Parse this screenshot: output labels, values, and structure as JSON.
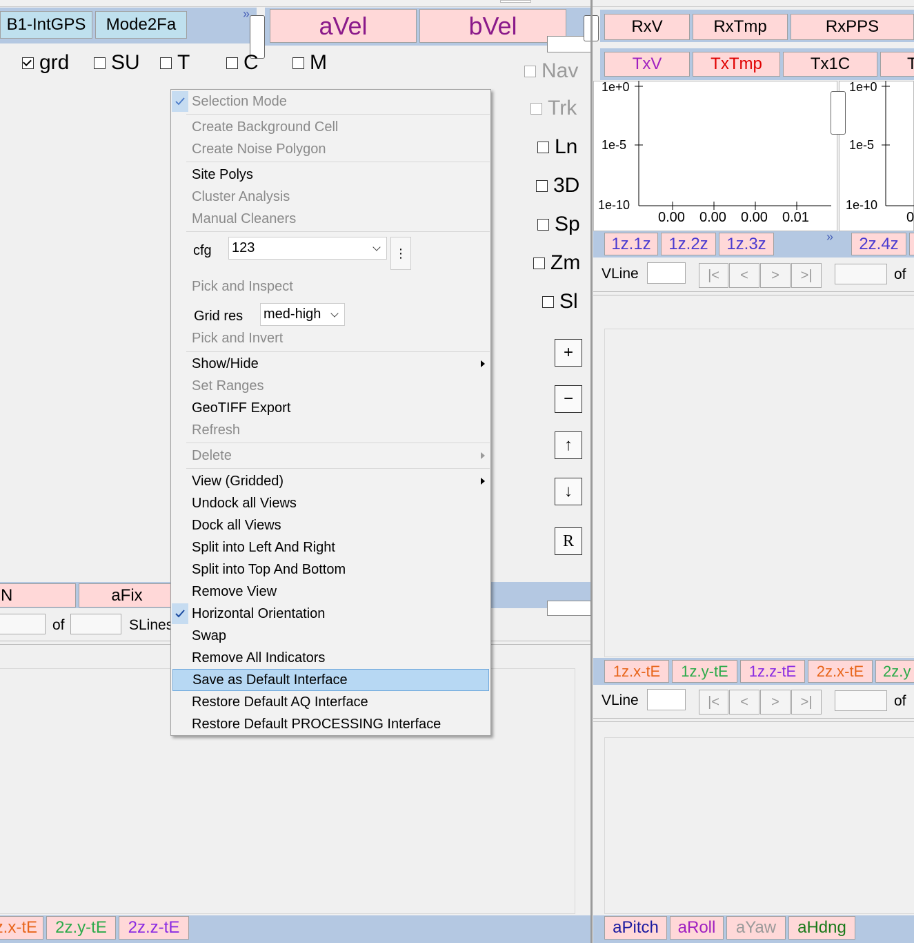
{
  "left_top_tabs": [
    "B1-IntGPS",
    "Mode2Fa"
  ],
  "center_tabs": [
    "aVel",
    "bVel"
  ],
  "checkboxes_top": [
    {
      "label": "grd",
      "checked": true
    },
    {
      "label": "SU",
      "checked": false
    },
    {
      "label": "T",
      "checked": false
    },
    {
      "label": "C",
      "checked": false
    },
    {
      "label": "M",
      "checked": false
    }
  ],
  "side_checkboxes": [
    {
      "label": "Nav",
      "enabled": false
    },
    {
      "label": "Trk",
      "enabled": false
    },
    {
      "label": "Ln",
      "enabled": true
    },
    {
      "label": "3D",
      "enabled": true
    },
    {
      "label": "Sp",
      "enabled": true
    },
    {
      "label": "Zm",
      "enabled": true
    },
    {
      "label": "Sl",
      "enabled": true
    }
  ],
  "side_buttons": [
    "+",
    "−",
    "↑",
    "↓",
    "R"
  ],
  "right_tabs_row1": [
    "RxV",
    "RxTmp",
    "RxPPS"
  ],
  "right_tabs_row2": [
    {
      "label": "TxV",
      "color": "#a020c0"
    },
    {
      "label": "TxTmp",
      "color": "#e00000"
    },
    {
      "label": "Tx1C",
      "color": "#000000"
    },
    {
      "label": "T",
      "color": "#000000"
    }
  ],
  "plot": {
    "y_ticks": [
      "1e+0",
      "1e-5",
      "1e-10"
    ],
    "x_ticks": [
      "0.00",
      "0.00",
      "0.00",
      "0.01"
    ],
    "y_ticks_2": [
      "1e+0",
      "1e-5",
      "1e-10"
    ],
    "x_tick_2": "0"
  },
  "z_tabs": [
    "1z.1z",
    "1z.2z",
    "1z.3z",
    "2z.4z"
  ],
  "nav1": {
    "label": "VLine",
    "buttons": [
      "|<",
      "<",
      ">",
      ">|"
    ],
    "of": "of"
  },
  "mid_left_tabs": [
    "N",
    "aFix"
  ],
  "mid_left_nav": {
    "of": "of",
    "label": "SLines"
  },
  "tE_tabs_right": [
    {
      "label": "1z.x-tE",
      "color": "#e8661c"
    },
    {
      "label": "1z.y-tE",
      "color": "#2caa4a"
    },
    {
      "label": "1z.z-tE",
      "color": "#8a2be2"
    },
    {
      "label": "2z.x-tE",
      "color": "#e8661c"
    },
    {
      "label": "2z.y",
      "color": "#2caa4a"
    }
  ],
  "nav2": {
    "label": "VLine",
    "buttons": [
      "|<",
      "<",
      ">",
      ">|"
    ],
    "of": "of"
  },
  "bottom_left_tabs": [
    {
      "label": "z.x-tE",
      "color": "#e8661c"
    },
    {
      "label": "2z.y-tE",
      "color": "#2caa4a"
    },
    {
      "label": "2z.z-tE",
      "color": "#8a2be2"
    }
  ],
  "bottom_right_tabs": [
    {
      "label": "aPitch",
      "color": "#1a1aa0"
    },
    {
      "label": "aRoll",
      "color": "#a020c0"
    },
    {
      "label": "aYaw",
      "color": "#9a9a9a"
    },
    {
      "label": "aHdng",
      "color": "#1a7a1a"
    }
  ],
  "menu": {
    "selection_mode": "Selection Mode",
    "create_background_cell": "Create Background Cell",
    "create_noise_polygon": "Create Noise Polygon",
    "site_polys": "Site Polys",
    "cluster_analysis": "Cluster Analysis",
    "manual_cleaners": "Manual Cleaners",
    "cfg_label": "cfg",
    "cfg_value": "123",
    "more_glyph": "⋮",
    "pick_and_inspect": "Pick and Inspect",
    "grid_res_label": "Grid res",
    "grid_res_value": "med-high",
    "pick_and_invert": "Pick and Invert",
    "show_hide": "Show/Hide",
    "set_ranges": "Set Ranges",
    "geotiff_export": "GeoTIFF Export",
    "refresh": "Refresh",
    "delete": "Delete",
    "view_gridded": "View (Gridded)",
    "undock_all_views": "Undock all Views",
    "dock_all_views": "Dock all Views",
    "split_left_right": "Split into Left And Right",
    "split_top_bottom": "Split into Top And Bottom",
    "remove_view": "Remove View",
    "horizontal_orientation": "Horizontal Orientation",
    "swap": "Swap",
    "remove_all_indicators": "Remove All Indicators",
    "save_default_interface": "Save as Default Interface",
    "restore_aq_interface": "Restore Default AQ Interface",
    "restore_processing_interface": "Restore Default PROCESSING Interface"
  },
  "scroll_glyph": "»"
}
